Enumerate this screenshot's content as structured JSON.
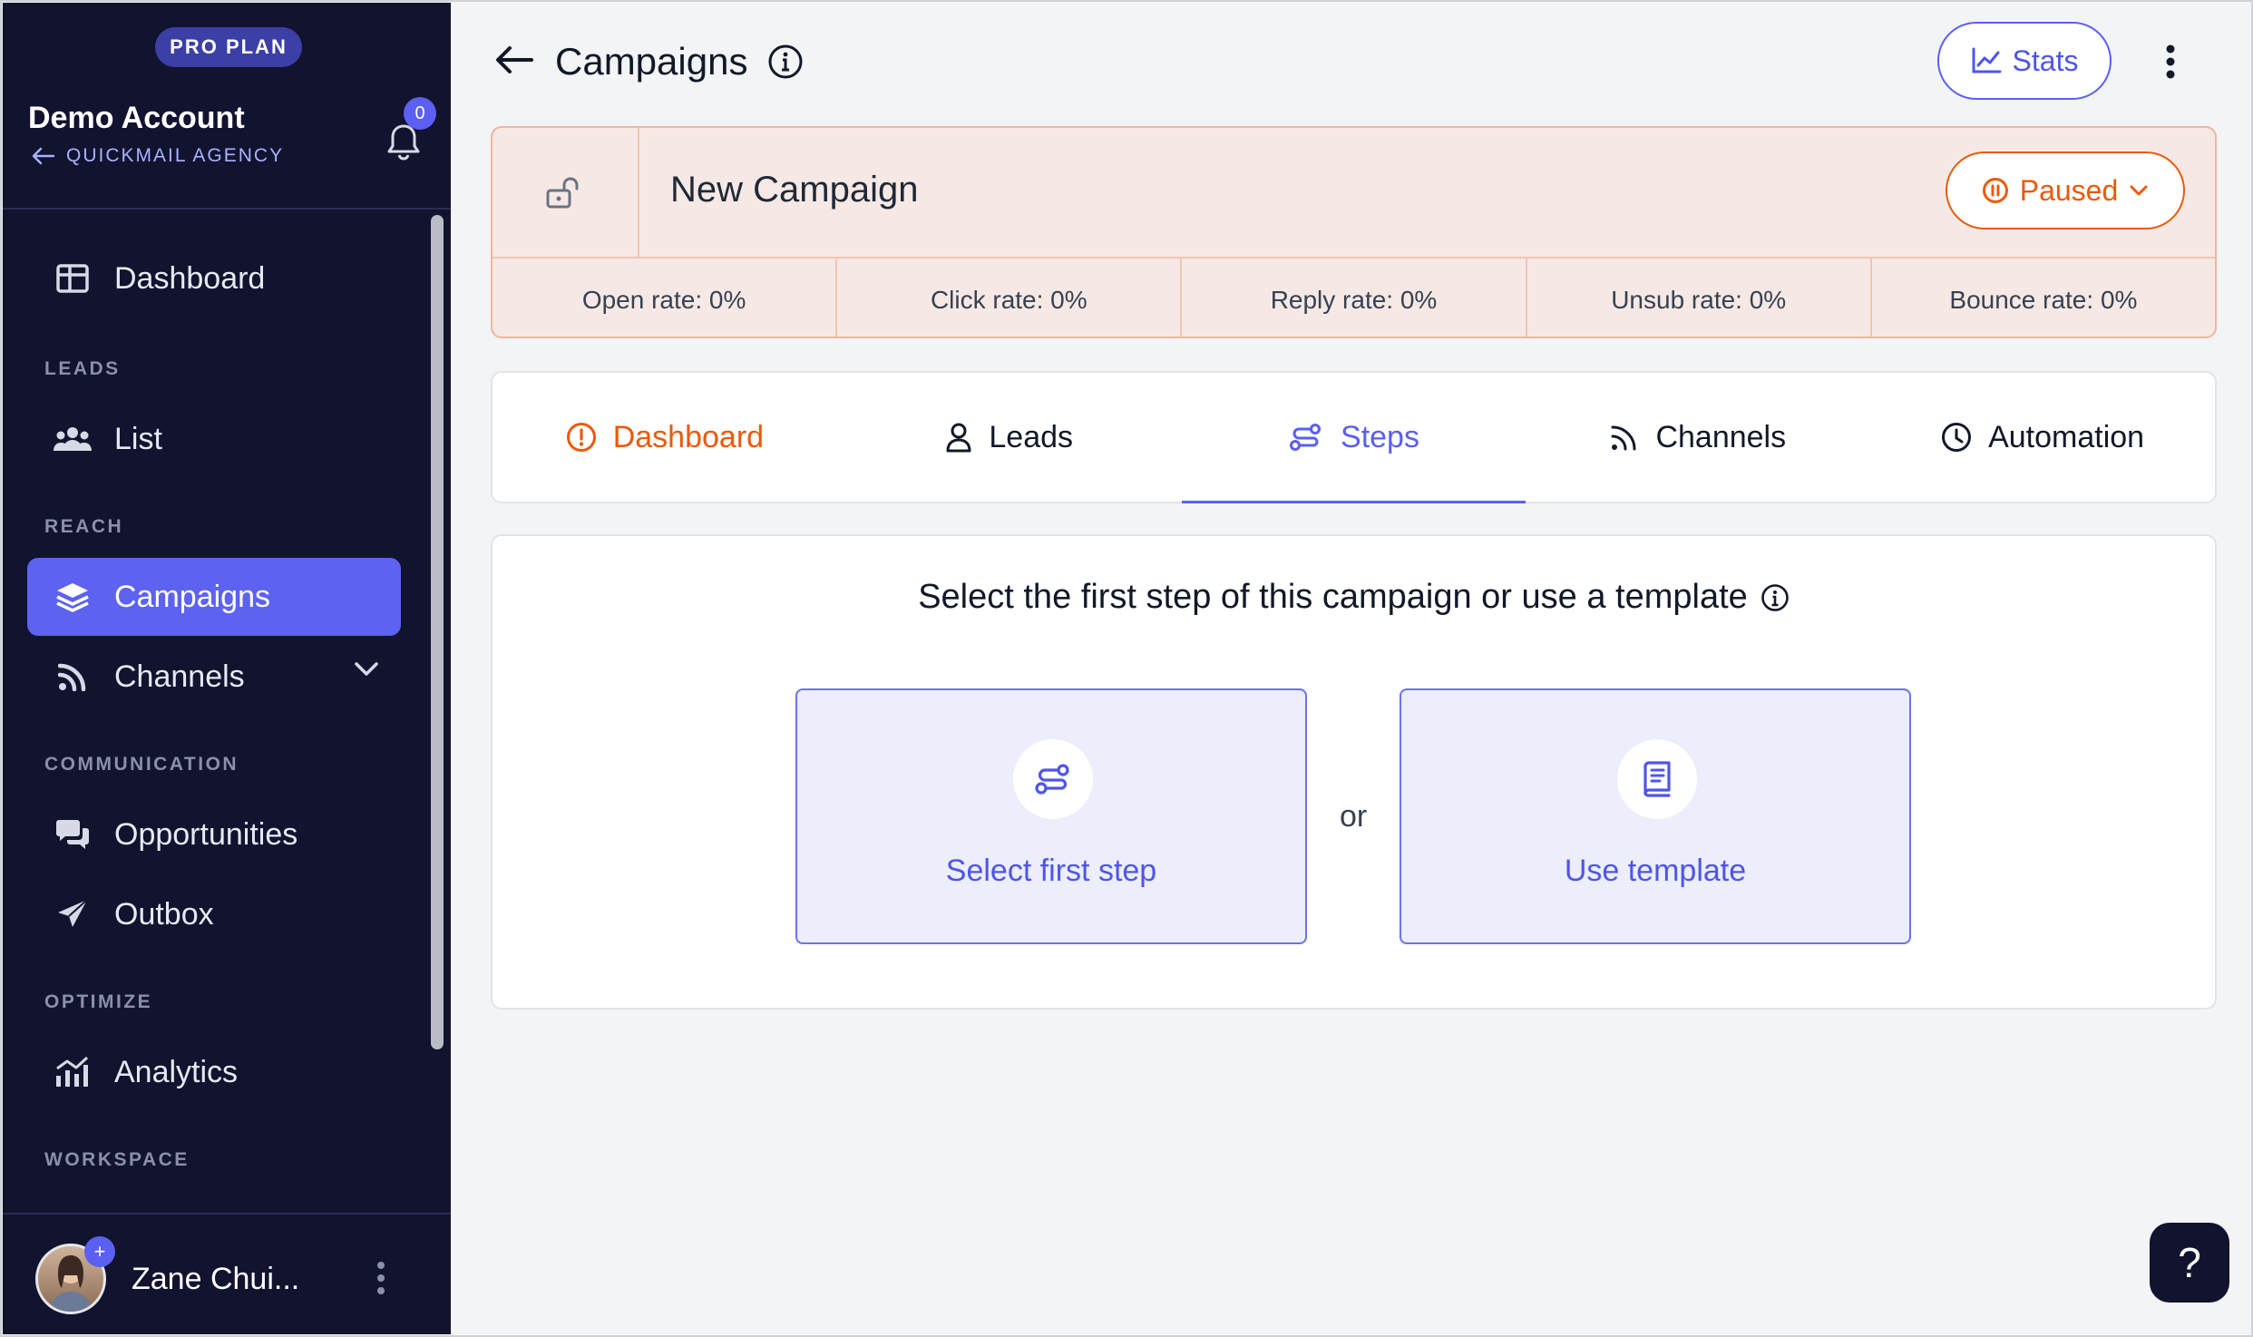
{
  "sidebar": {
    "plan_badge": "PRO PLAN",
    "account_name": "Demo Account",
    "account_sub": "QUICKMAIL AGENCY",
    "notification_count": "0",
    "dashboard": "Dashboard",
    "sections": {
      "leads": "LEADS",
      "reach": "REACH",
      "communication": "COMMUNICATION",
      "optimize": "OPTIMIZE",
      "workspace": "WORKSPACE"
    },
    "items": {
      "list": "List",
      "campaigns": "Campaigns",
      "channels": "Channels",
      "opportunities": "Opportunities",
      "outbox": "Outbox",
      "analytics": "Analytics"
    },
    "user_name": "Zane Chui..."
  },
  "header": {
    "title": "Campaigns",
    "stats_label": "Stats"
  },
  "campaign": {
    "name": "New Campaign",
    "status": "Paused",
    "rates": {
      "open": "Open rate: 0%",
      "click": "Click rate: 0%",
      "reply": "Reply rate: 0%",
      "unsub": "Unsub rate: 0%",
      "bounce": "Bounce rate: 0%"
    }
  },
  "tabs": {
    "dashboard": "Dashboard",
    "leads": "Leads",
    "steps": "Steps",
    "channels": "Channels",
    "automation": "Automation",
    "selected": "Steps"
  },
  "main": {
    "heading": "Select the first step of this campaign or use a template",
    "option_first": "Select first step",
    "or": "or",
    "option_template": "Use template"
  },
  "help_label": "?",
  "colors": {
    "accent": "#5b5ff2",
    "sidebar_bg": "#11132f",
    "status_orange": "#ea5a0c",
    "campaign_bg": "#f6e9e5"
  }
}
